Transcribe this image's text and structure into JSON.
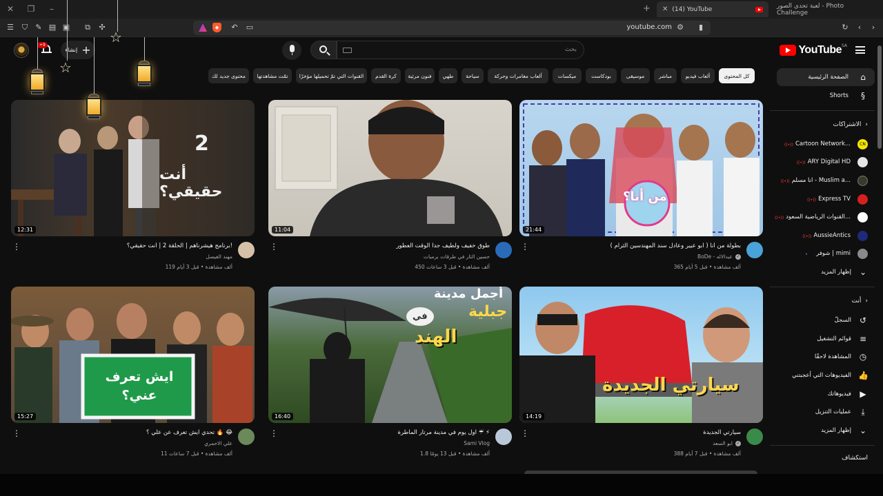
{
  "browser": {
    "tabs": [
      {
        "label": "(14) YouTube",
        "active": true
      },
      {
        "label": "لعبة تحدي الصور - Photo Challenge",
        "active": false
      }
    ],
    "url": "youtube.com"
  },
  "header": {
    "logo_text": "YouTube",
    "region": "SA",
    "search_placeholder": "بحث",
    "create_label": "إنشاء",
    "notification_count": "+9"
  },
  "chips": [
    {
      "label": "كل المحتوى",
      "selected": true
    },
    {
      "label": "ألعاب فيديو"
    },
    {
      "label": "مباشر"
    },
    {
      "label": "موسيقى"
    },
    {
      "label": "بودكاست"
    },
    {
      "label": "ميكسات"
    },
    {
      "label": "ألعاب مغامرات وحركة"
    },
    {
      "label": "سياحة"
    },
    {
      "label": "طهي"
    },
    {
      "label": "فنون مرئية"
    },
    {
      "label": "كرة القدم"
    },
    {
      "label": "القنوات التي تمّ تحميلها مؤخرًا"
    },
    {
      "label": "تمّت مشاهدتها"
    },
    {
      "label": "محتوى جديد لك"
    }
  ],
  "sidebar": {
    "main": [
      {
        "label": "الصفحة الرئيسية",
        "icon": "home-icon",
        "active": true
      },
      {
        "label": "Shorts",
        "icon": "shorts-icon"
      }
    ],
    "subscriptions_heading": "الاشتراكات",
    "subscriptions": [
      {
        "label": "Cartoon Network...",
        "color": "#f5e400"
      },
      {
        "label": "ARY Digital HD",
        "color": "#e6e6e6"
      },
      {
        "label": "انا مسلم - Muslim a...",
        "color": "#3a3a2a"
      },
      {
        "label": "Express TV",
        "color": "#d61f1f"
      },
      {
        "label": "القنوات الرياضية السعود...",
        "color": "#ffffff"
      },
      {
        "label": "AussieAntics",
        "color": "#1e2a7a"
      },
      {
        "label": "شوفر | mimi",
        "color": "#8a8a8a"
      }
    ],
    "subs_show_more": "إظهار المزيد",
    "you_heading": "أنت",
    "you_items": [
      {
        "label": "السجلّ",
        "icon": "history-icon"
      },
      {
        "label": "قوائم التشغيل",
        "icon": "playlists-icon"
      },
      {
        "label": "المشاهدة لاحقًا",
        "icon": "watch-later-icon"
      },
      {
        "label": "الفيديوهات التي أعجبتني",
        "icon": "thumbs-up-icon"
      },
      {
        "label": "فيديوهاتك",
        "icon": "your-videos-icon"
      },
      {
        "label": "عمليات التنزيل",
        "icon": "download-icon"
      }
    ],
    "you_show_more": "إظهار المزيد",
    "explore_heading": "استكشاف"
  },
  "videos": [
    {
      "title": "بطولة من أنا ( ابو عبير وعادل سند المهندسين الثرام )",
      "channel": "BoDe - عبدالاله",
      "verified": true,
      "meta": "365 ألف مشاهدة • قبل 5 أيام",
      "duration": "21:44",
      "avatar_color": "#4aa3d8"
    },
    {
      "title": "طوق خفيف ولطيف جدا الوقت العطور",
      "channel": "حسين الثار في طرقات برمبات",
      "verified": false,
      "meta": "450 ألف مشاهدة • قبل 3 ساعات",
      "duration": "11:04",
      "avatar_color": "#2a6bb8"
    },
    {
      "title": "برنامج هيشرناهم | الحلقة 2 | أنت حقيقي؟!",
      "channel": "مهند الفيصل",
      "verified": false,
      "meta": "119 ألف مشاهدة • قبل 3 أيام",
      "duration": "12:31",
      "avatar_color": "#d6c0a8"
    },
    {
      "title": "سيارتي الجديدة",
      "channel": "ابو السعد",
      "verified": true,
      "meta": "388 ألف مشاهدة • قبل 7 أيام",
      "duration": "14:19",
      "avatar_color": "#3a8a4a"
    },
    {
      "title": "اول يوم في مدينة مرتار الماطرة ☔ ⚡",
      "channel": "Sami Vlog",
      "verified": false,
      "meta": "1.8 ألف مشاهدة • قبل 13 يومًا",
      "duration": "16:40",
      "avatar_color": "#b9c8d8"
    },
    {
      "title": "تحدي ايش تعرف عن علي ؟ 🔥 😂",
      "channel": "علي الاحمري",
      "verified": false,
      "meta": "11 ألف مشاهدة • قبل 7 ساعات",
      "duration": "15:27",
      "avatar_color": "#6a8a5a"
    }
  ],
  "thumb_overlays": {
    "v2_text": "أنت حقيقي؟",
    "v2_num": "2",
    "v1_text": "من أنا؟",
    "v3_text": "سيارتي الجديدة",
    "v4_line1": "أجمل مدينة",
    "v4_line2": "في",
    "v4_line3": "الهند",
    "v4_line4": "جبلية",
    "v5_sign": "ايش تعرف عني؟"
  },
  "colors": {
    "accent": "#ff0000",
    "bg": "#0f0f0f",
    "chip": "#272727"
  }
}
